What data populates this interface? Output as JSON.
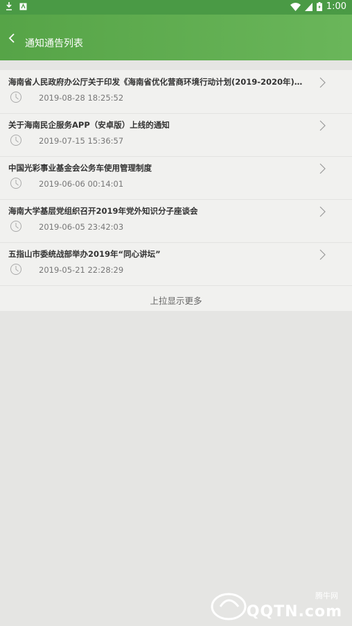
{
  "status_bar": {
    "time": "1:00",
    "icons": [
      "download-icon",
      "notification-icon",
      "wifi-icon",
      "signal-icon",
      "battery-icon"
    ]
  },
  "app_bar": {
    "title": "通知通告列表"
  },
  "notices": [
    {
      "title": "海南省人民政府办公厅关于印发《海南省优化营商环境行动计划(2019-2020年)》...",
      "date": "2019-08-28 18:25:52"
    },
    {
      "title": "关于海南民企服务APP（安卓版）上线的通知",
      "date": "2019-07-15 15:36:57"
    },
    {
      "title": "中国光彩事业基金会公务车使用管理制度",
      "date": "2019-06-06 00:14:01"
    },
    {
      "title": "海南大学基层党组织召开2019年党外知识分子座谈会",
      "date": "2019-06-05 23:42:03"
    },
    {
      "title": "五指山市委统战部举办2019年“同心讲坛”",
      "date": "2019-05-21 22:28:29"
    }
  ],
  "load_more": "上拉显示更多",
  "watermark": {
    "site": "QQTN.com",
    "cn": "腾牛网"
  }
}
